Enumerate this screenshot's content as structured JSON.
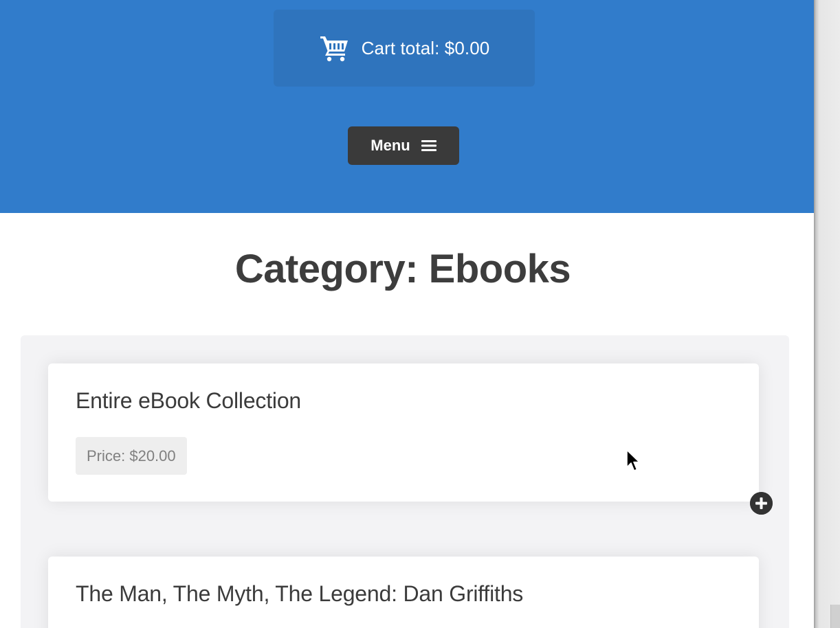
{
  "header": {
    "cart": {
      "icon": "shopping-cart-icon",
      "label": "Cart total: $0.00"
    },
    "menu": {
      "label": "Menu",
      "icon": "hamburger-icon"
    },
    "colors": {
      "header_bg": "#317ccb",
      "cart_box_bg": "#2f74bd",
      "menu_bg": "#3a3a3a"
    }
  },
  "page": {
    "title_prefix": "Category: ",
    "title_strong": "Ebooks"
  },
  "products": [
    {
      "title": "Entire eBook Collection",
      "price": "Price: $20.00",
      "add_icon": "plus-circle-icon"
    },
    {
      "title": "The Man, The Myth, The Legend: Dan Griffiths"
    }
  ],
  "cursor": {
    "icon": "mouse-pointer-icon"
  }
}
